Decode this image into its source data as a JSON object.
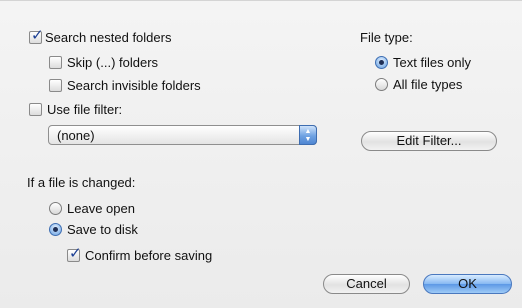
{
  "search": {
    "nested_label": "Search nested folders",
    "skip_label": "Skip (...) folders",
    "invisible_label": "Search invisible folders",
    "use_filter_label": "Use file filter:",
    "filter_value": "(none)",
    "edit_filter_label": "Edit Filter..."
  },
  "file_type": {
    "heading": "File type:",
    "text_only_label": "Text files only",
    "all_types_label": "All file types"
  },
  "changed": {
    "heading": "If a file is changed:",
    "leave_open_label": "Leave open",
    "save_to_disk_label": "Save to disk",
    "confirm_label": "Confirm before saving"
  },
  "actions": {
    "cancel_label": "Cancel",
    "ok_label": "OK"
  },
  "state": {
    "search_nested": true,
    "skip_folders": false,
    "search_invisible": false,
    "use_file_filter": false,
    "file_type": "Text files only",
    "if_changed": "Save to disk",
    "confirm_before_saving": true
  }
}
